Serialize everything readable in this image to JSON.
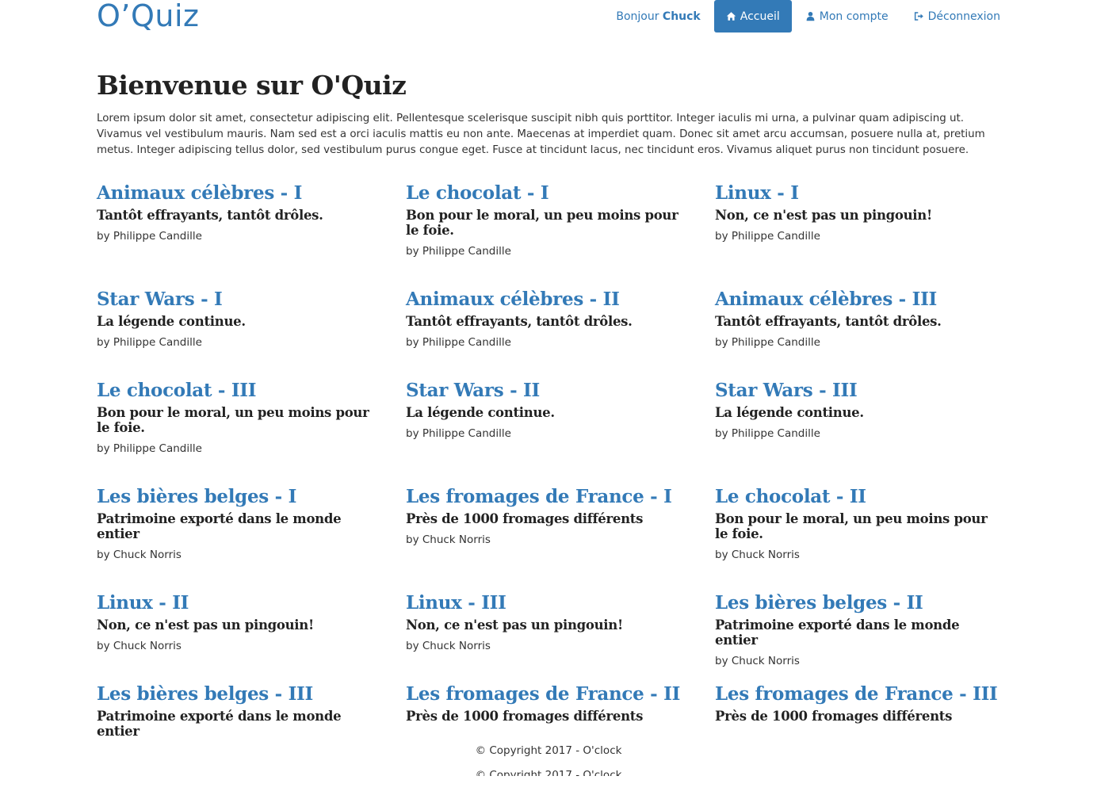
{
  "header": {
    "brand": "O’Quiz",
    "greeting_prefix": "Bonjour ",
    "greeting_user": "Chuck",
    "nav": {
      "home": "Accueil",
      "account": "Mon compte",
      "logout": "Déconnexion"
    }
  },
  "intro": {
    "title": "Bienvenue sur O'Quiz",
    "text": "Lorem ipsum dolor sit amet, consectetur adipiscing elit. Pellentesque scelerisque suscipit nibh quis porttitor. Integer iaculis mi urna, a pulvinar quam adipiscing ut. Vivamus vel vestibulum mauris. Nam sed est a orci iaculis mattis eu non ante. Maecenas at imperdiet quam. Donec sit amet arcu accumsan, posuere nulla at, pretium metus. Integer adipiscing tellus dolor, sed vestibulum purus congue eget. Fusce at tincidunt lacus, nec tincidunt eros. Vivamus aliquet purus non tincidunt posuere."
  },
  "quizzes": [
    {
      "title": "Animaux célèbres - I",
      "subtitle": "Tantôt effrayants, tantôt drôles.",
      "author": "by Philippe Candille"
    },
    {
      "title": "Le chocolat - I",
      "subtitle": "Bon pour le moral, un peu moins pour le foie.",
      "author": "by Philippe Candille"
    },
    {
      "title": "Linux - I",
      "subtitle": "Non, ce n'est pas un pingouin!",
      "author": "by Philippe Candille"
    },
    {
      "title": "Star Wars - I",
      "subtitle": "La légende continue.",
      "author": "by Philippe Candille"
    },
    {
      "title": "Animaux célèbres - II",
      "subtitle": "Tantôt effrayants, tantôt drôles.",
      "author": "by Philippe Candille"
    },
    {
      "title": "Animaux célèbres - III",
      "subtitle": "Tantôt effrayants, tantôt drôles.",
      "author": "by Philippe Candille"
    },
    {
      "title": "Le chocolat - III",
      "subtitle": "Bon pour le moral, un peu moins pour le foie.",
      "author": "by Philippe Candille"
    },
    {
      "title": "Star Wars - II",
      "subtitle": "La légende continue.",
      "author": "by Philippe Candille"
    },
    {
      "title": "Star Wars - III",
      "subtitle": "La légende continue.",
      "author": "by Philippe Candille"
    },
    {
      "title": "Les bières belges - I",
      "subtitle": "Patrimoine exporté dans le monde entier",
      "author": "by Chuck Norris"
    },
    {
      "title": "Les fromages de France - I",
      "subtitle": "Près de 1000 fromages différents",
      "author": "by Chuck Norris"
    },
    {
      "title": "Le chocolat - II",
      "subtitle": "Bon pour le moral, un peu moins pour le foie.",
      "author": "by Chuck Norris"
    },
    {
      "title": "Linux - II",
      "subtitle": "Non, ce n'est pas un pingouin!",
      "author": "by Chuck Norris"
    },
    {
      "title": "Linux - III",
      "subtitle": "Non, ce n'est pas un pingouin!",
      "author": "by Chuck Norris"
    },
    {
      "title": "Les bières belges - II",
      "subtitle": "Patrimoine exporté dans le monde entier",
      "author": "by Chuck Norris"
    },
    {
      "title": "Les bières belges - III",
      "subtitle": "Patrimoine exporté dans le monde entier",
      "author": ""
    },
    {
      "title": "Les fromages de France - II",
      "subtitle": "Près de 1000 fromages différents",
      "author": ""
    },
    {
      "title": "Les fromages de France - III",
      "subtitle": "Près de 1000 fromages différents",
      "author": ""
    }
  ],
  "footer": {
    "copyright": "© Copyright 2017 - O'clock"
  },
  "colors": {
    "accent": "#337ab7",
    "text": "#333333",
    "heading": "#222222"
  }
}
